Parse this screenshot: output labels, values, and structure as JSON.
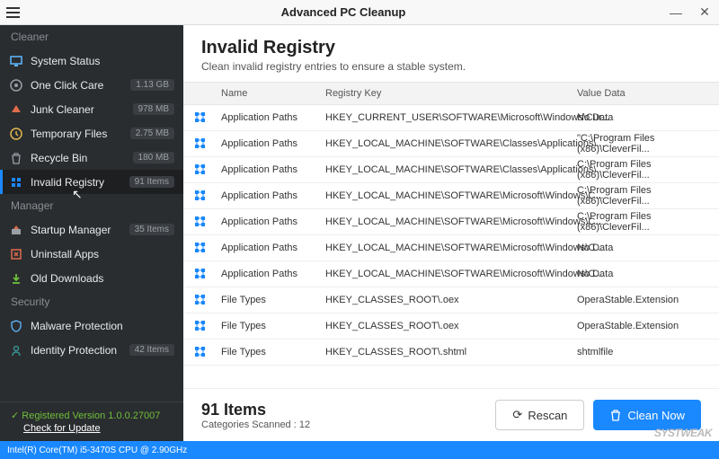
{
  "titlebar": {
    "title": "Advanced PC Cleanup"
  },
  "sidebar": {
    "sections": {
      "cleaner": "Cleaner",
      "manager": "Manager",
      "security": "Security"
    },
    "items": [
      {
        "label": "System Status",
        "badge": ""
      },
      {
        "label": "One Click Care",
        "badge": "1.13 GB"
      },
      {
        "label": "Junk Cleaner",
        "badge": "978 MB"
      },
      {
        "label": "Temporary Files",
        "badge": "2.75 MB"
      },
      {
        "label": "Recycle Bin",
        "badge": "180 MB"
      },
      {
        "label": "Invalid Registry",
        "badge": "91 Items"
      },
      {
        "label": "Startup Manager",
        "badge": "35 Items"
      },
      {
        "label": "Uninstall Apps",
        "badge": ""
      },
      {
        "label": "Old Downloads",
        "badge": ""
      },
      {
        "label": "Malware Protection",
        "badge": ""
      },
      {
        "label": "Identity Protection",
        "badge": "42 Items"
      }
    ],
    "registered": "Registered Version 1.0.0.27007",
    "update": "Check for Update"
  },
  "status": "Intel(R) Core(TM) i5-3470S CPU @ 2.90GHz",
  "head": {
    "title": "Invalid Registry",
    "sub": "Clean invalid registry entries to ensure a stable system."
  },
  "cols": {
    "name": "Name",
    "key": "Registry Key",
    "val": "Value Data"
  },
  "rows": [
    {
      "name": "Application Paths",
      "key": "HKEY_CURRENT_USER\\SOFTWARE\\Microsoft\\Windows\\Cur...",
      "val": "No Data"
    },
    {
      "name": "Application Paths",
      "key": "HKEY_LOCAL_MACHINE\\SOFTWARE\\Classes\\Applications\\...",
      "val": "\"C:\\Program Files (x86)\\CleverFil..."
    },
    {
      "name": "Application Paths",
      "key": "HKEY_LOCAL_MACHINE\\SOFTWARE\\Classes\\Applications\\...",
      "val": "C:\\Program Files (x86)\\CleverFil..."
    },
    {
      "name": "Application Paths",
      "key": "HKEY_LOCAL_MACHINE\\SOFTWARE\\Microsoft\\Windows\\C...",
      "val": "C:\\Program Files (x86)\\CleverFil..."
    },
    {
      "name": "Application Paths",
      "key": "HKEY_LOCAL_MACHINE\\SOFTWARE\\Microsoft\\Windows\\C...",
      "val": "C:\\Program Files (x86)\\CleverFil..."
    },
    {
      "name": "Application Paths",
      "key": "HKEY_LOCAL_MACHINE\\SOFTWARE\\Microsoft\\Windows\\C...",
      "val": "No Data"
    },
    {
      "name": "Application Paths",
      "key": "HKEY_LOCAL_MACHINE\\SOFTWARE\\Microsoft\\Windows\\C...",
      "val": "No Data"
    },
    {
      "name": "File Types",
      "key": "HKEY_CLASSES_ROOT\\.oex",
      "val": "OperaStable.Extension"
    },
    {
      "name": "File Types",
      "key": "HKEY_CLASSES_ROOT\\.oex",
      "val": "OperaStable.Extension"
    },
    {
      "name": "File Types",
      "key": "HKEY_CLASSES_ROOT\\.shtml",
      "val": "shtmlfile"
    }
  ],
  "foot": {
    "count": "91 Items",
    "cat": "Categories Scanned : 12",
    "rescan": "Rescan",
    "clean": "Clean Now"
  },
  "watermark": "SYSTWEAK"
}
